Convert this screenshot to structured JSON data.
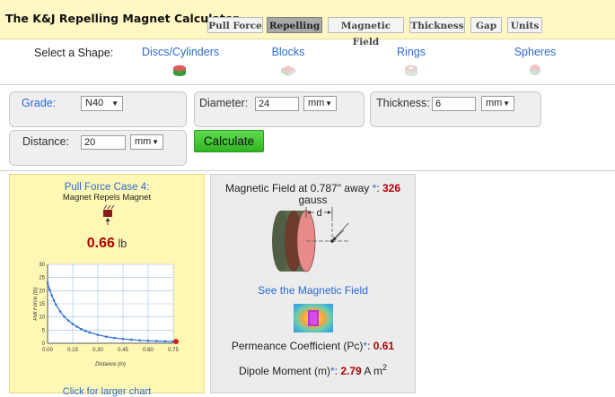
{
  "header": {
    "title": "The K&J Repelling Magnet Calculator",
    "nav": [
      "Pull Force",
      "Repelling",
      "Magnetic Field",
      "Thickness",
      "Gap",
      "Units"
    ],
    "active_nav": "Repelling"
  },
  "shapes": {
    "label": "Select a Shape:",
    "items": [
      "Discs/Cylinders",
      "Blocks",
      "Rings",
      "Spheres"
    ]
  },
  "inputs": {
    "grade_label": "Grade:",
    "grade_value": "N40",
    "diameter_label": "Diameter:",
    "diameter_value": "24",
    "diameter_unit": "mm",
    "thickness_label": "Thickness:",
    "thickness_value": "6",
    "thickness_unit": "mm",
    "distance_label": "Distance:",
    "distance_value": "20",
    "distance_unit": "mm",
    "calculate_label": "Calculate"
  },
  "pull_force": {
    "title": "Pull Force Case 4:",
    "subtitle": "Magnet Repels Magnet",
    "value": "0.66",
    "unit": "lb",
    "larger_chart_link": "Click for larger chart"
  },
  "chart_data": {
    "type": "line",
    "xlabel": "Distance (in)",
    "ylabel": "Pull Force (lb)",
    "xlim": [
      0,
      0.75
    ],
    "ylim": [
      0,
      30
    ],
    "xticks": [
      "0.00",
      "0.15",
      "0.30",
      "0.45",
      "0.60",
      "0.75"
    ],
    "yticks": [
      "0",
      "5",
      "10",
      "15",
      "20",
      "25",
      "30"
    ],
    "grid": true,
    "x": [
      0.0,
      0.0125,
      0.025,
      0.0375,
      0.05,
      0.075,
      0.1,
      0.125,
      0.15,
      0.175,
      0.2,
      0.225,
      0.25,
      0.3,
      0.35,
      0.4,
      0.45,
      0.5,
      0.55,
      0.6,
      0.65,
      0.7,
      0.75
    ],
    "y": [
      23.0,
      20.4,
      18.2,
      16.3,
      14.7,
      12.1,
      10.1,
      8.6,
      7.3,
      6.3,
      5.4,
      4.7,
      4.1,
      3.2,
      2.5,
      2.0,
      1.65,
      1.35,
      1.1,
      0.95,
      0.82,
      0.72,
      0.66
    ],
    "highlight": {
      "x": 0.787,
      "y": 0.66
    }
  },
  "field": {
    "title_prefix": "Magnetic Field at 0.787\" away ",
    "star": "*",
    "colon": ":",
    "value": "326",
    "unit": "gauss",
    "diagram_label": "d",
    "see_field_link": "See the Magnetic Field",
    "permeance_label": "Permeance Coefficient (Pc)",
    "permeance_value": "0.61",
    "dipole_label": "Dipole Moment (m)",
    "dipole_value": "2.79",
    "dipole_unit": "A m",
    "dipole_exp": "2"
  },
  "colors": {
    "accent_link": "#2b6bd6",
    "result_red": "#b00000",
    "panel_yellow": "#fff8b4",
    "button_green": "#3cc52f"
  }
}
